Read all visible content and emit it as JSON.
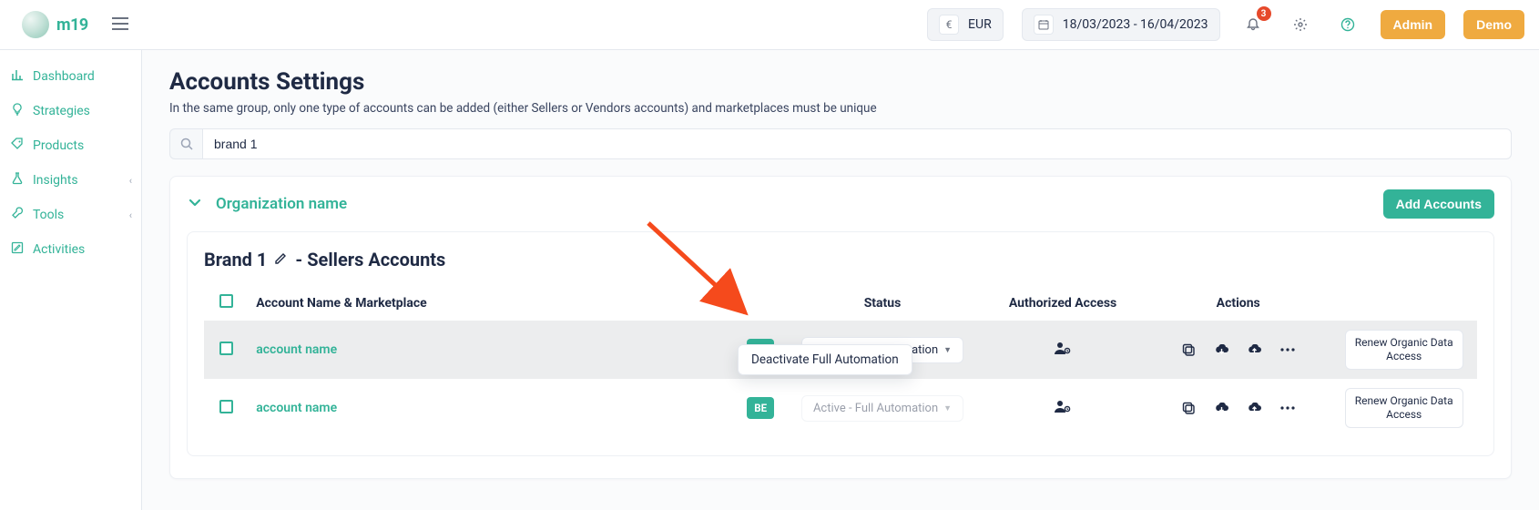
{
  "brand": {
    "name": "m19"
  },
  "topbar": {
    "currency_label": "EUR",
    "daterange_label": "18/03/2023 - 16/04/2023",
    "notification_count": "3",
    "admin_label": "Admin",
    "demo_label": "Demo"
  },
  "sidebar": {
    "items": [
      {
        "icon": "chart-icon",
        "label": "Dashboard",
        "submenu": false
      },
      {
        "icon": "lightbulb-icon",
        "label": "Strategies",
        "submenu": false
      },
      {
        "icon": "tag-icon",
        "label": "Products",
        "submenu": false
      },
      {
        "icon": "flask-icon",
        "label": "Insights",
        "submenu": true
      },
      {
        "icon": "wrench-icon",
        "label": "Tools",
        "submenu": true
      },
      {
        "icon": "edit-square-icon",
        "label": "Activities",
        "submenu": false
      }
    ]
  },
  "page": {
    "title": "Accounts Settings",
    "subtitle": "In the same group, only one type of accounts can be added (either Sellers or Vendors accounts) and marketplaces must be unique",
    "search_value": "brand 1"
  },
  "org": {
    "name": "Organization name",
    "add_accounts_label": "Add Accounts"
  },
  "inner": {
    "brand_name": "Brand 1",
    "section_suffix": " - Sellers Accounts",
    "columns": {
      "col_name": "Account Name & Marketplace",
      "col_status": "Status",
      "col_access": "Authorized Access",
      "col_actions": "Actions"
    },
    "rows": [
      {
        "name": "account name",
        "flag": "FR",
        "status": "Active - Full Automation",
        "renew_label": "Renew Organic Data Access"
      },
      {
        "name": "account name",
        "flag": "BE",
        "status": "Active - Full Automation",
        "renew_label": "Renew Organic Data Access"
      }
    ],
    "dropdown_option": "Deactivate Full Automation"
  }
}
